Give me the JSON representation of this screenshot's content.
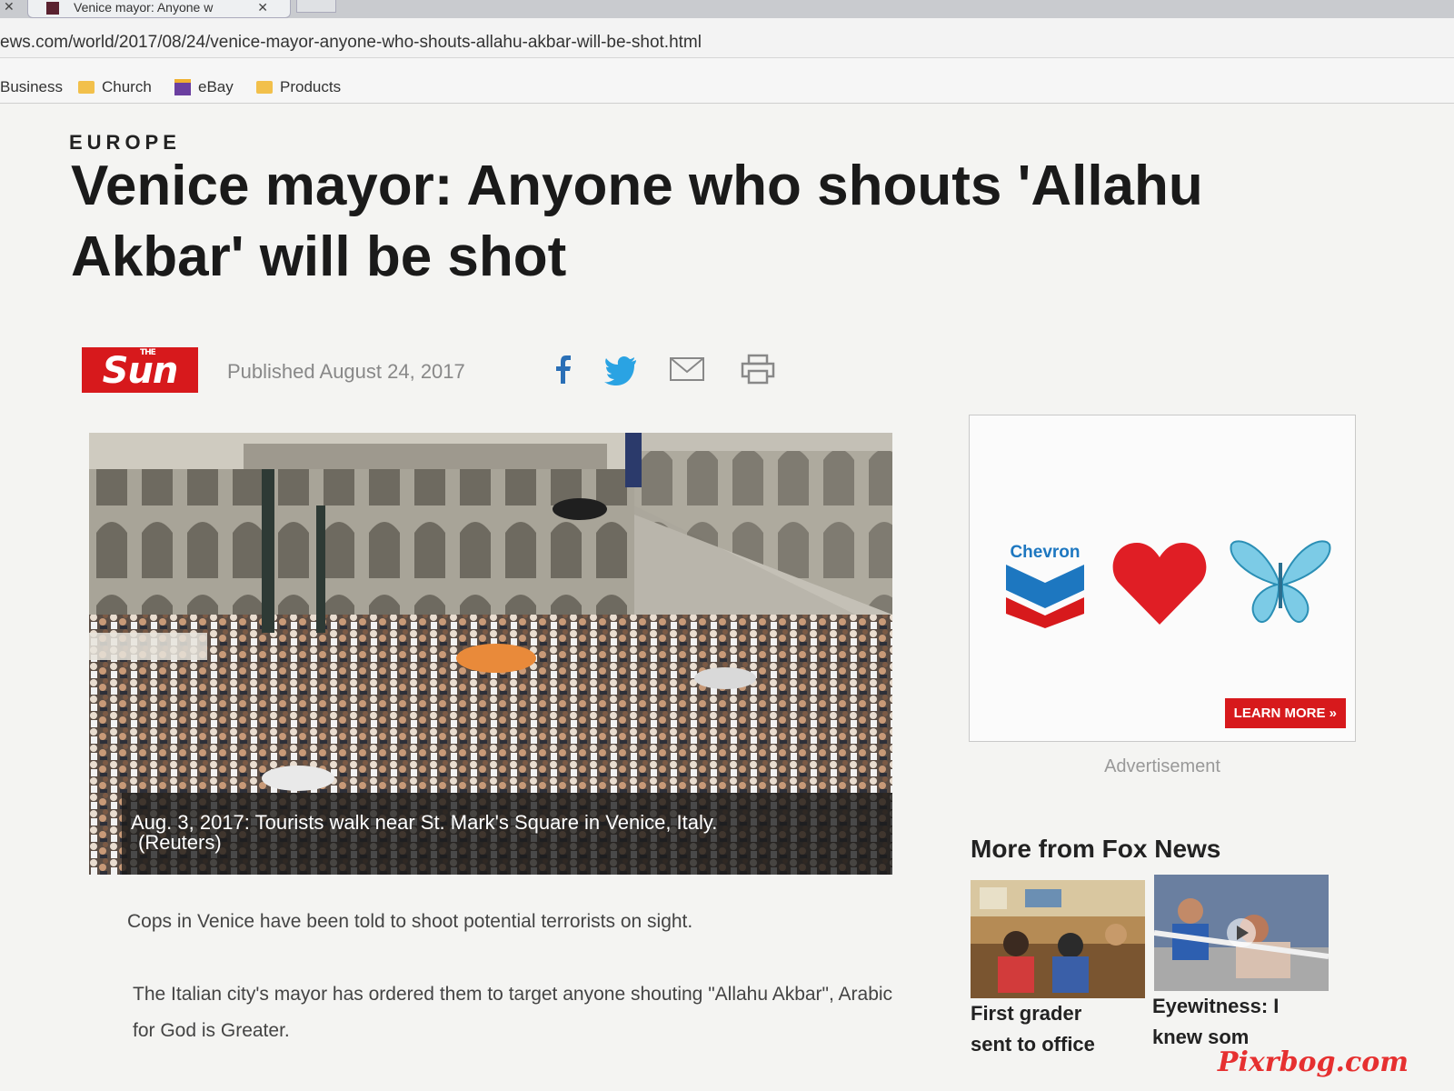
{
  "browser": {
    "tab_title": "Venice mayor: Anyone w",
    "url": "ews.com/world/2017/08/24/venice-mayor-anyone-who-shouts-allahu-akbar-will-be-shot.html",
    "bookmarks": [
      "Business",
      "Church",
      "eBay",
      "Products"
    ]
  },
  "article": {
    "section": "EUROPE",
    "headline": "Venice mayor: Anyone who shouts 'Allahu Akbar' will be shot",
    "source_logo": "Sun",
    "source_logo_small": "THE",
    "published": "Published August 24, 2017",
    "image_caption_line1": "Aug. 3, 2017: Tourists walk near St. Mark's Square in Venice, Italy.",
    "image_caption_line2": "(Reuters)",
    "paragraphs": [
      "Cops in Venice have been told to shoot potential terrorists on sight.",
      "The Italian city's mayor has ordered them to target anyone shouting \"Allahu Akbar\", Arabic for God is Greater."
    ]
  },
  "sidebar": {
    "ad_brand": "Chevron",
    "ad_button": "LEARN MORE »",
    "ad_label": "Advertisement",
    "more_title": "More from Fox News",
    "stories": [
      {
        "title_line1": "First grader",
        "title_line2": "sent to office"
      },
      {
        "title_line1": "Eyewitness: I",
        "title_line2": "knew som"
      }
    ]
  },
  "watermark": "Pixrbog.com"
}
